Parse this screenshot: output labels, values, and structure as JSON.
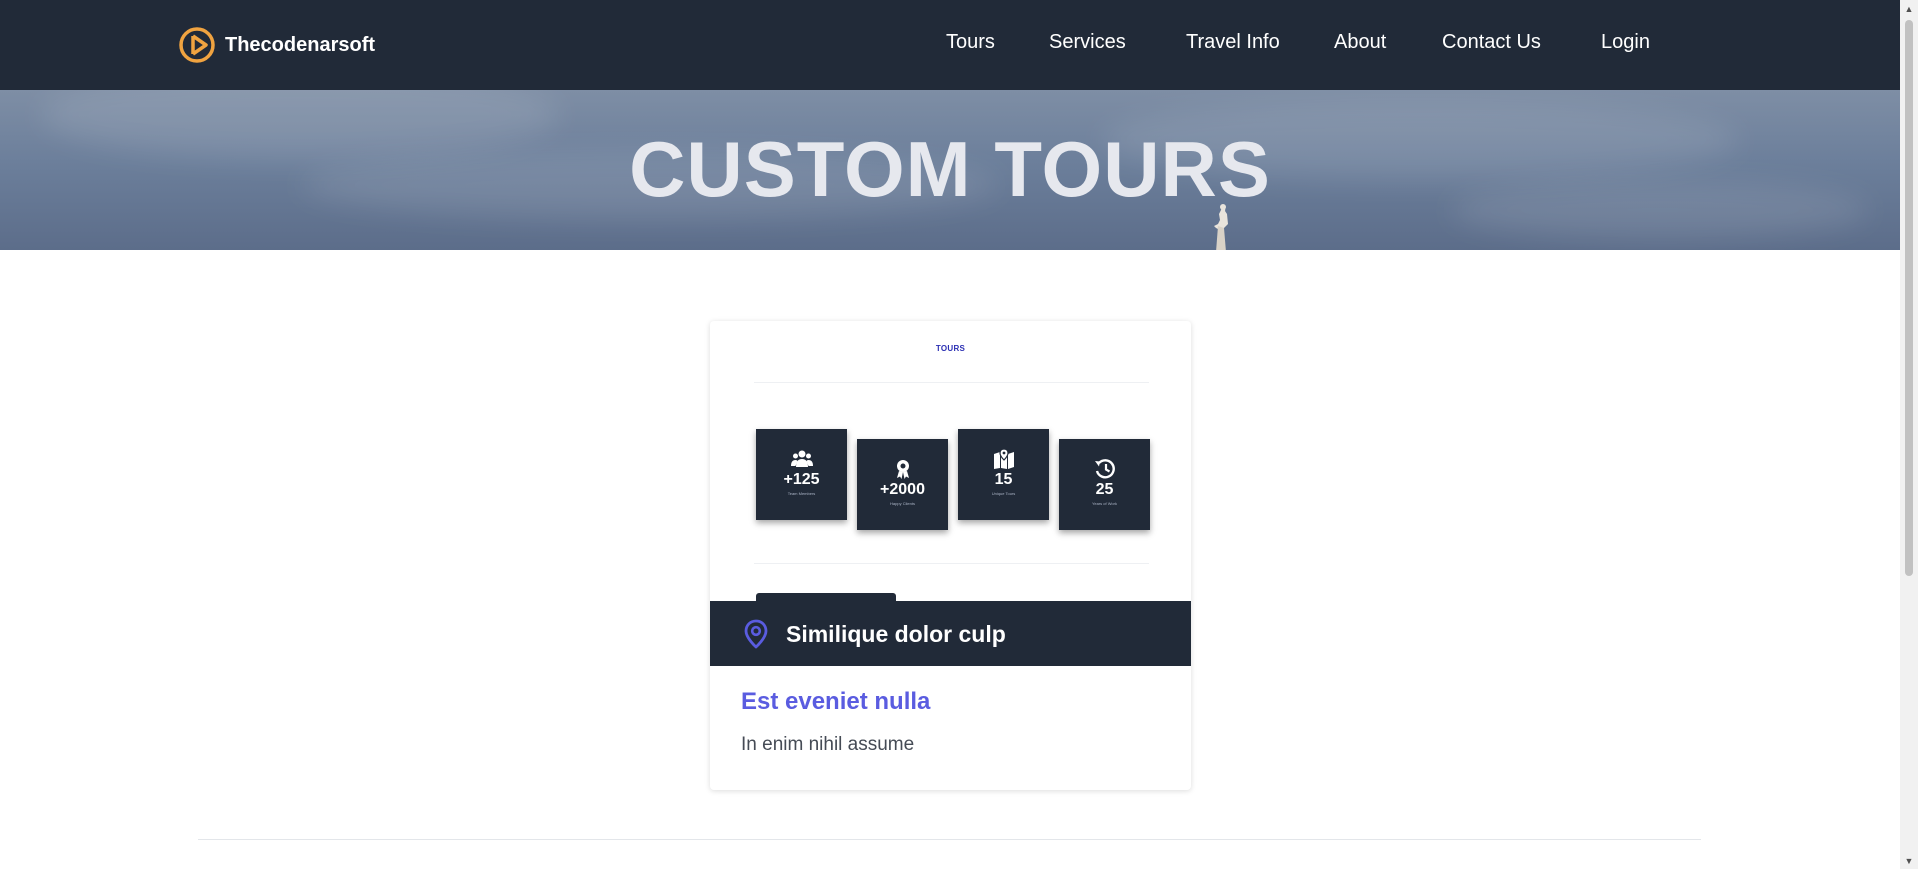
{
  "nav": {
    "brand": "Thecodenarsoft",
    "links": [
      "Tours",
      "Services",
      "Travel Info",
      "About",
      "Contact Us",
      "Login"
    ]
  },
  "hero": {
    "title": "CUSTOM TOURS"
  },
  "card": {
    "label": "TOURS",
    "stats": [
      {
        "icon": "users-icon",
        "value": "+125",
        "label": "Team Members"
      },
      {
        "icon": "award-icon",
        "value": "+2000",
        "label": "Happy Clients"
      },
      {
        "icon": "map-pin-icon",
        "value": "15",
        "label": "Unique Tours"
      },
      {
        "icon": "history-icon",
        "value": "25",
        "label": "Years of Work"
      }
    ],
    "location": "Similique dolor culp",
    "title": "Est eveniet nulla",
    "text": "In enim nihil assume"
  },
  "colors": {
    "navbar": "#212a38",
    "accent": "#5a5ce0",
    "logo": "#f0a340"
  }
}
